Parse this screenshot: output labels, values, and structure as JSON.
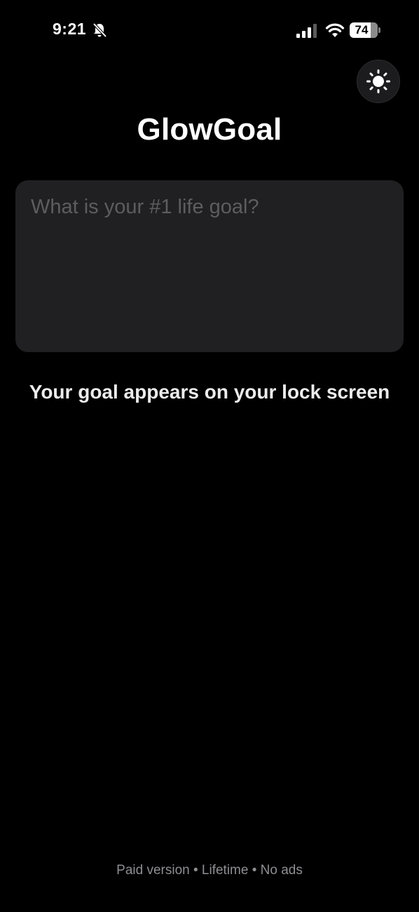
{
  "status_bar": {
    "time": "9:21",
    "battery_level": "74",
    "icons": [
      "bell-slash-icon",
      "cellular-signal-icon",
      "wifi-icon",
      "battery-icon"
    ]
  },
  "header": {
    "theme_toggle_icon": "sun-icon",
    "title": "GlowGoal"
  },
  "goal": {
    "placeholder": "What is your #1 life goal?",
    "value": ""
  },
  "subtitle": "Your goal appears on your lock screen",
  "footer": "Paid version • Lifetime • No ads",
  "colors": {
    "background": "#000000",
    "input_background": "#202022",
    "placeholder": "#5d5d60",
    "footer_text": "#8e8e93"
  }
}
